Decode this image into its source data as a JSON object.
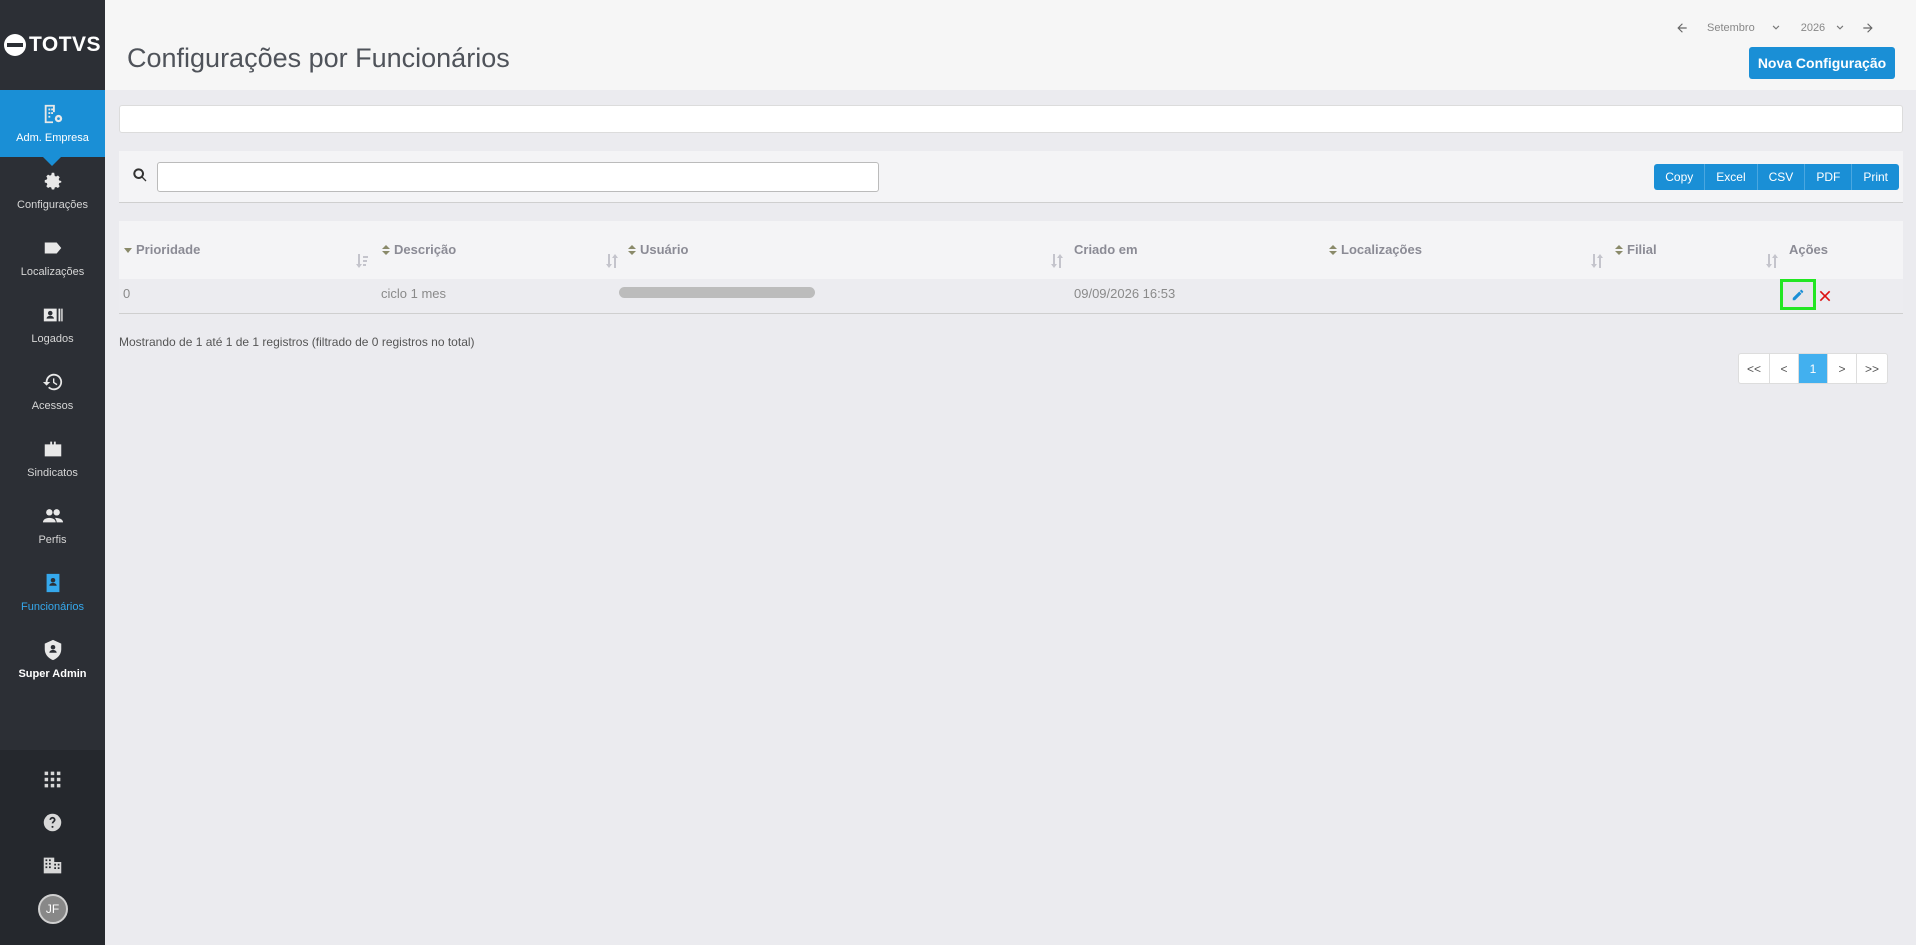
{
  "brand": {
    "name": "TOTVS"
  },
  "sidebar": {
    "items": [
      {
        "label": "Adm. Empresa",
        "icon": "building-gear-icon"
      },
      {
        "label": "Configurações",
        "icon": "gear-icon"
      },
      {
        "label": "Localizações",
        "icon": "tag-icon"
      },
      {
        "label": "Logados",
        "icon": "id-card-icon"
      },
      {
        "label": "Acessos",
        "icon": "history-icon"
      },
      {
        "label": "Sindicatos",
        "icon": "briefcase-icon"
      },
      {
        "label": "Perfis",
        "icon": "people-icon"
      },
      {
        "label": "Funcionários",
        "icon": "badge-icon"
      },
      {
        "label": "Super Admin",
        "icon": "shield-user-icon"
      }
    ],
    "bottom": {
      "apps_icon": "grid-icon",
      "help_icon": "help-icon",
      "company_icon": "company-icon",
      "avatar_initials": "JF"
    }
  },
  "header": {
    "title": "Configurações por Funcionários",
    "month": "Setembro",
    "year": "2026",
    "new_button": "Nova Configuração"
  },
  "search": {
    "value": "",
    "placeholder": ""
  },
  "export_buttons": [
    "Copy",
    "Excel",
    "CSV",
    "PDF",
    "Print"
  ],
  "table": {
    "columns": [
      "Prioridade",
      "Descrição",
      "Usuário",
      "Criado em",
      "Localizações",
      "Filial",
      "Ações"
    ],
    "rows": [
      {
        "prioridade": "0",
        "descricao": "ciclo 1 mes",
        "usuario": "",
        "criado_em": "09/09/2026 16:53",
        "localizacoes": "",
        "filial": ""
      }
    ]
  },
  "info": "Mostrando de 1 até 1 de 1 registros (filtrado de 0 registros no total)",
  "pagination": [
    "<<",
    "<",
    "1",
    ">",
    ">>"
  ],
  "colors": {
    "primary": "#1a8fd6",
    "sidebar": "#2c2f35",
    "highlight": "#22e622",
    "delete": "#dd1111"
  }
}
